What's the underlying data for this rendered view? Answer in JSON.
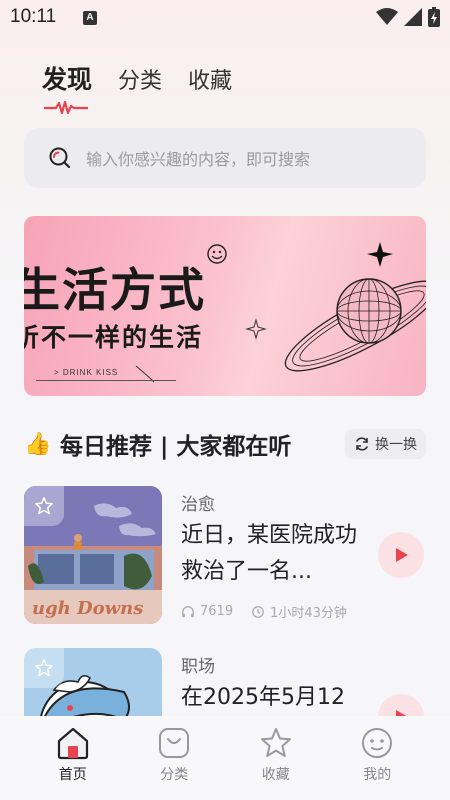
{
  "status_bar": {
    "time": "10:11",
    "notification_letter": "A"
  },
  "top_tabs": [
    {
      "label": "发现",
      "active": true
    },
    {
      "label": "分类",
      "active": false
    },
    {
      "label": "收藏",
      "active": false
    }
  ],
  "search": {
    "placeholder": "输入你感兴趣的内容，即可搜索"
  },
  "banner": {
    "title": "生活方式",
    "subtitle": "听不一样的生活",
    "tag": "> DRINK KISS"
  },
  "section": {
    "emoji": "👍",
    "title": "每日推荐 | 大家都在听",
    "refresh_label": "换一换"
  },
  "cards": [
    {
      "category": "治愈",
      "title": "近日，某医院成功救治了一名...",
      "plays": "7619",
      "duration": "1小时43分钟"
    },
    {
      "category": "职场",
      "title": "在2025年5月12",
      "plays": "",
      "duration": ""
    }
  ],
  "bottom_nav": [
    {
      "label": "首页",
      "icon": "home-icon",
      "active": true
    },
    {
      "label": "分类",
      "icon": "category-icon",
      "active": false
    },
    {
      "label": "收藏",
      "icon": "star-icon",
      "active": false
    },
    {
      "label": "我的",
      "icon": "profile-icon",
      "active": false
    }
  ],
  "colors": {
    "accent": "#e8434f",
    "play_bg": "#fbe1e3",
    "banner_pink": "#f7a3b8"
  }
}
